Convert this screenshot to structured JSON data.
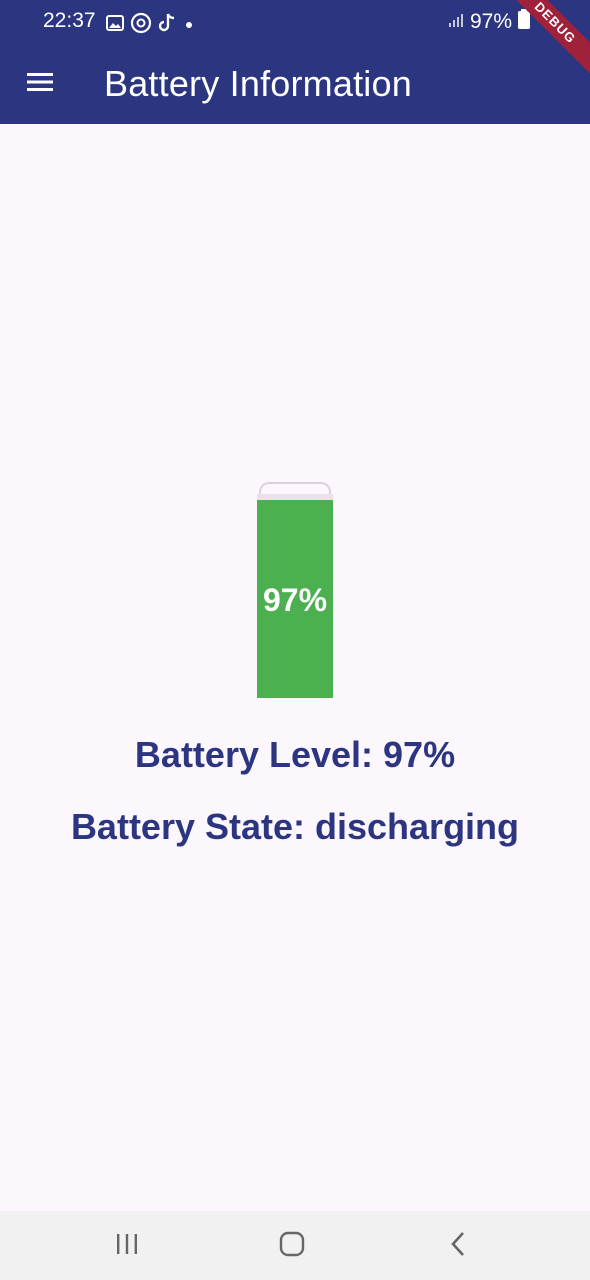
{
  "status_bar": {
    "time": "22:37",
    "battery_percent": "97%",
    "icons_left": [
      "image-icon",
      "threads-icon",
      "tiktok-icon",
      "dot-icon"
    ],
    "icons_right": [
      "signal-icon",
      "battery-icon"
    ]
  },
  "app_bar": {
    "title": "Battery Information",
    "menu_icon": "menu-icon"
  },
  "debug_banner": "DEBUG",
  "battery": {
    "level": 0.97,
    "label": "97%",
    "fill_color": "#4caf50"
  },
  "info": {
    "level_text": "Battery Level: 97%",
    "state_text": "Battery State: discharging"
  },
  "nav_bar": {
    "icons": [
      "recents-icon",
      "home-icon",
      "back-icon"
    ]
  },
  "colors": {
    "primary": "#2b3580",
    "background": "#fcf6fd",
    "battery_fill": "#4caf50",
    "debug_ribbon": "#a0213a"
  }
}
